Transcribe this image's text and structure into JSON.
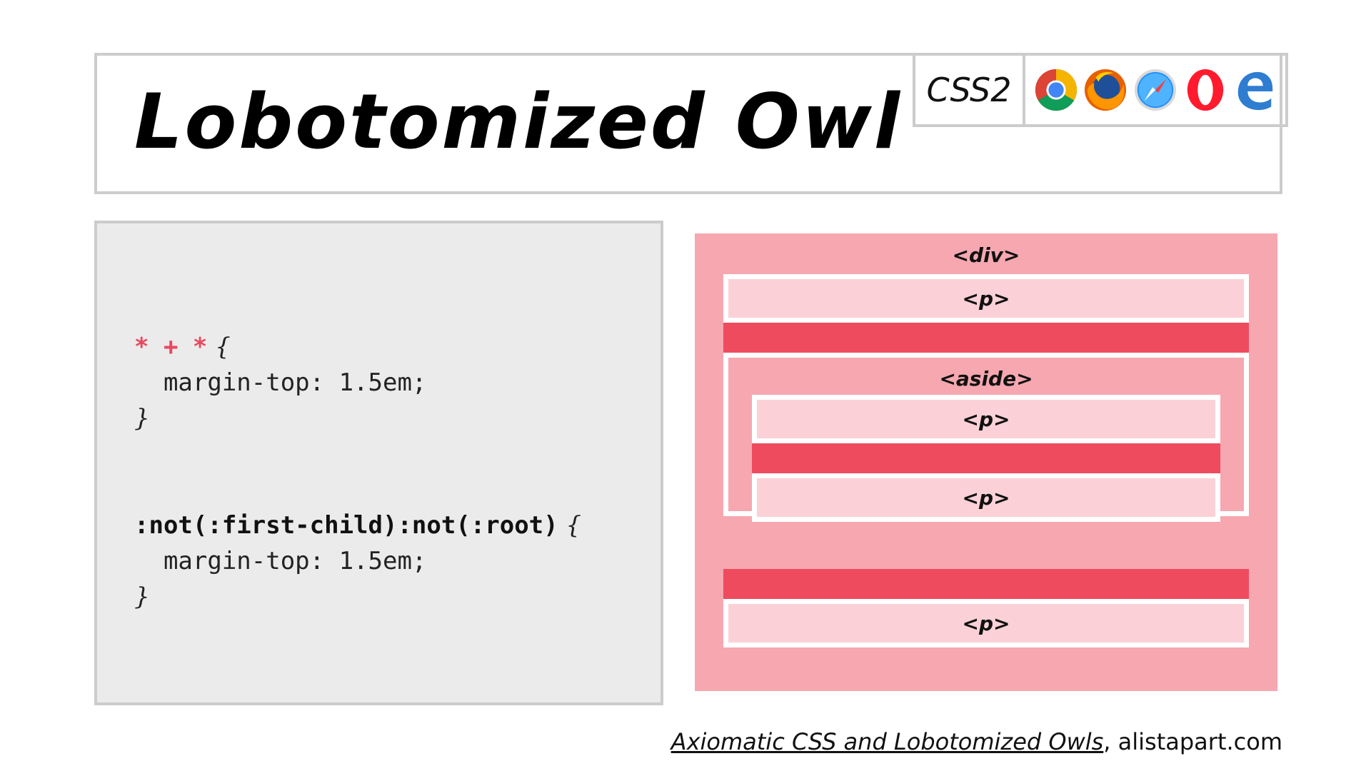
{
  "title": "Lobotomized Owl",
  "css_badge": "CSS2",
  "browsers": [
    {
      "name": "Chrome",
      "icon": "chrome-icon"
    },
    {
      "name": "Firefox",
      "icon": "firefox-icon"
    },
    {
      "name": "Safari",
      "icon": "safari-icon"
    },
    {
      "name": "Opera",
      "icon": "opera-icon"
    },
    {
      "name": "Edge",
      "icon": "edge-icon"
    }
  ],
  "code": {
    "block1": {
      "selector": "* + *",
      "open": " {",
      "declaration": "  margin-top: 1.5em;",
      "close": "}"
    },
    "block2": {
      "selector": ":not(:first-child):not(:root)",
      "open": " {",
      "declaration": "  margin-top: 1.5em;",
      "close": "}"
    }
  },
  "diagram": {
    "outer": "<div>",
    "p1": "<p>",
    "aside": "<aside>",
    "aside_p1": "<p>",
    "aside_p2": "<p>",
    "p_last": "<p>"
  },
  "footer": {
    "citation": "Axiomatic CSS and Lobotomized Owls",
    "source": ", alistapart.com"
  },
  "colors": {
    "accent_red": "#ef4b5f",
    "pink_outer": "#f6a7b0",
    "pink_light": "#fbd1d7",
    "panel_gray": "#ebebeb",
    "border_gray": "#cccccc"
  }
}
